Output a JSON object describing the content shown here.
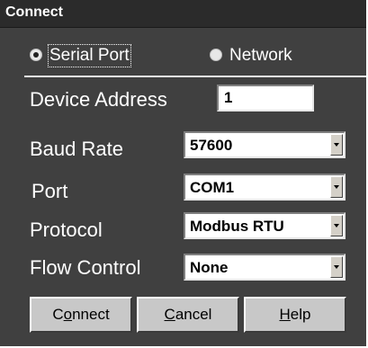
{
  "window": {
    "title": "Connect"
  },
  "connection_type": {
    "options": [
      {
        "label": "Serial Port",
        "selected": true
      },
      {
        "label": "Network",
        "selected": false
      }
    ]
  },
  "fields": {
    "device_address": {
      "label": "Device Address",
      "value": "1"
    },
    "baud_rate": {
      "label": "Baud Rate",
      "value": "57600"
    },
    "port": {
      "label": "Port",
      "value": "COM1"
    },
    "protocol": {
      "label": "Protocol",
      "value": "Modbus RTU"
    },
    "flow_control": {
      "label": "Flow Control",
      "value": "None"
    }
  },
  "buttons": {
    "connect": {
      "label": "Connect",
      "mnemonic": "o"
    },
    "cancel": {
      "label": "Cancel",
      "mnemonic": "C"
    },
    "help": {
      "label": "Help",
      "mnemonic": "H"
    }
  },
  "icons": {
    "dropdown": "chevron-down-icon",
    "radio": "radio-icon"
  }
}
